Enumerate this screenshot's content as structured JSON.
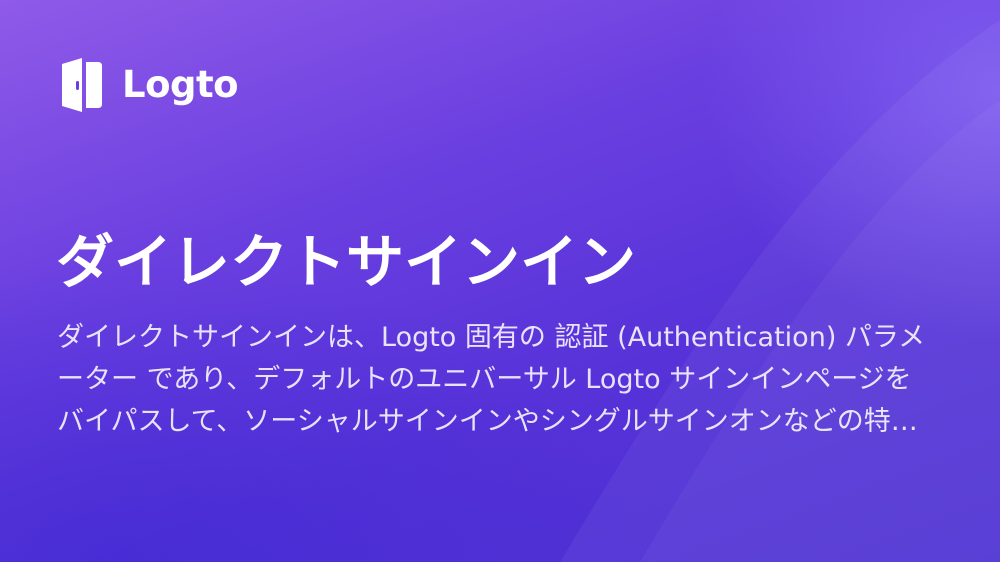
{
  "brand": {
    "name": "Logto",
    "logo_icon": "door-icon"
  },
  "title": "ダイレクトサインイン",
  "description": "ダイレクトサインインは、Logto 固有の 認証 (Authentication) パラメーター であり、デフォルトのユニバーサル Logto サインインページをバイパスして、ソーシャルサインインやシングルサインオンなどの特定のサインイン方法を直接呼び出すことができます。",
  "colors": {
    "background_top": "#8f5ae8",
    "background_bottom": "#4a2fd2",
    "text": "#ffffff"
  }
}
